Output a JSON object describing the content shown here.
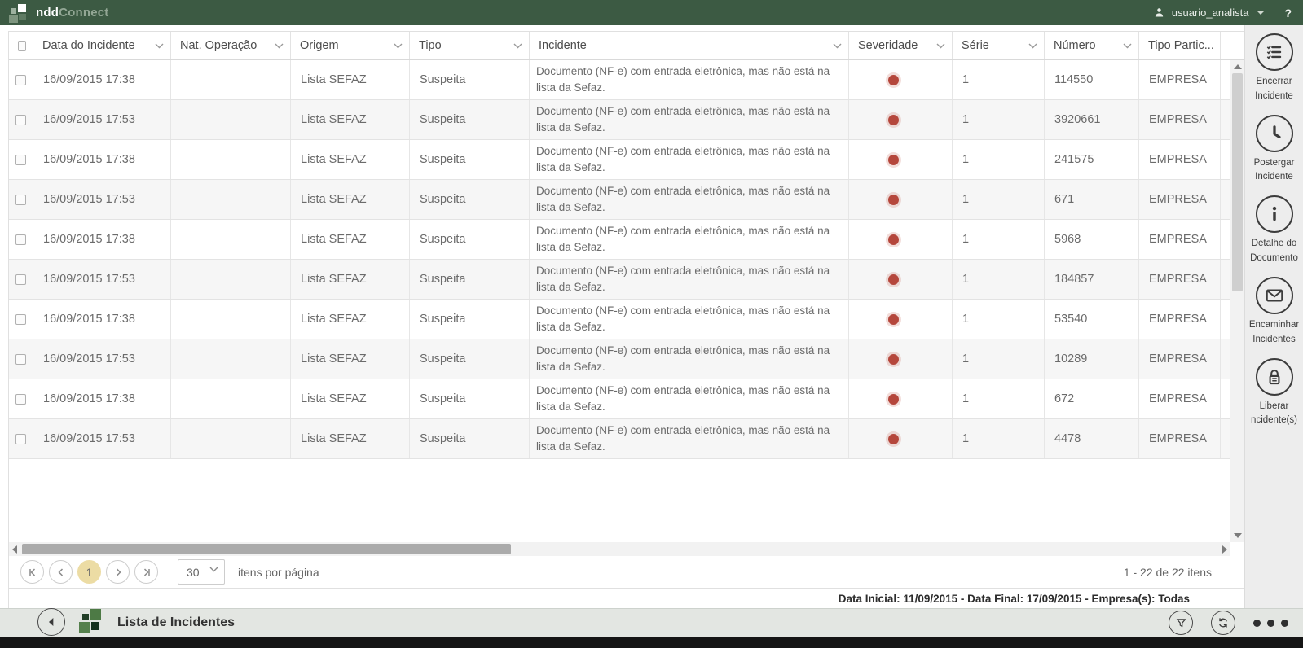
{
  "topbar": {
    "logo_bold": "ndd",
    "logo_light": "Connect",
    "username": "usuario_analista",
    "help_label": "?"
  },
  "table": {
    "columns": [
      {
        "label": "Data do Incidente"
      },
      {
        "label": "Nat. Operação"
      },
      {
        "label": "Origem"
      },
      {
        "label": "Tipo"
      },
      {
        "label": "Incidente"
      },
      {
        "label": "Severidade"
      },
      {
        "label": "Série"
      },
      {
        "label": "Número"
      },
      {
        "label": "Tipo Partic..."
      }
    ],
    "rows": [
      {
        "date": "16/09/2015 17:38",
        "nat_operacao": "",
        "origem": "Lista SEFAZ",
        "tipo": "Suspeita",
        "incidente": "Documento (NF-e)  com entrada eletrônica, mas não está na\nlista da Sefaz.",
        "severidade": "red",
        "serie": "1",
        "numero": "114550",
        "tipo_partic": "EMPRESA"
      },
      {
        "date": "16/09/2015 17:53",
        "nat_operacao": "",
        "origem": "Lista SEFAZ",
        "tipo": "Suspeita",
        "incidente": "Documento (NF-e) com entrada eletrônica, mas não está na\nlista da Sefaz.",
        "severidade": "red",
        "serie": "1",
        "numero": "3920661",
        "tipo_partic": "EMPRESA"
      },
      {
        "date": "16/09/2015 17:38",
        "nat_operacao": "",
        "origem": "Lista SEFAZ",
        "tipo": "Suspeita",
        "incidente": "Documento (NF-e)  com entrada eletrônica, mas não está na\nlista da Sefaz.",
        "severidade": "red",
        "serie": "1",
        "numero": "241575",
        "tipo_partic": "EMPRESA"
      },
      {
        "date": "16/09/2015 17:53",
        "nat_operacao": "",
        "origem": "Lista SEFAZ",
        "tipo": "Suspeita",
        "incidente": "Documento (NF-e) com entrada eletrônica, mas não está na\nlista da Sefaz.",
        "severidade": "red",
        "serie": "1",
        "numero": "671",
        "tipo_partic": "EMPRESA"
      },
      {
        "date": "16/09/2015 17:38",
        "nat_operacao": "",
        "origem": "Lista SEFAZ",
        "tipo": "Suspeita",
        "incidente": "Documento (NF-e)  com entrada eletrônica, mas não está na\nlista da Sefaz.",
        "severidade": "red",
        "serie": "1",
        "numero": "5968",
        "tipo_partic": "EMPRESA"
      },
      {
        "date": "16/09/2015 17:53",
        "nat_operacao": "",
        "origem": "Lista SEFAZ",
        "tipo": "Suspeita",
        "incidente": "Documento (NF-e) com entrada eletrônica, mas não está na\nlista da Sefaz.",
        "severidade": "red",
        "serie": "1",
        "numero": "184857",
        "tipo_partic": "EMPRESA"
      },
      {
        "date": "16/09/2015 17:38",
        "nat_operacao": "",
        "origem": "Lista SEFAZ",
        "tipo": "Suspeita",
        "incidente": "Documento (NF-e)  com entrada eletrônica, mas não está na\nlista da Sefaz.",
        "severidade": "red",
        "serie": "1",
        "numero": "53540",
        "tipo_partic": "EMPRESA"
      },
      {
        "date": "16/09/2015 17:53",
        "nat_operacao": "",
        "origem": "Lista SEFAZ",
        "tipo": "Suspeita",
        "incidente": "Documento (NF-e) com entrada eletrônica, mas não está na\nlista da Sefaz.",
        "severidade": "red",
        "serie": "1",
        "numero": "10289",
        "tipo_partic": "EMPRESA"
      },
      {
        "date": "16/09/2015 17:38",
        "nat_operacao": "",
        "origem": "Lista SEFAZ",
        "tipo": "Suspeita",
        "incidente": "Documento (NF-e)  com entrada eletrônica, mas não está na\nlista da Sefaz.",
        "severidade": "red",
        "serie": "1",
        "numero": "672",
        "tipo_partic": "EMPRESA"
      },
      {
        "date": "16/09/2015 17:53",
        "nat_operacao": "",
        "origem": "Lista SEFAZ",
        "tipo": "Suspeita",
        "incidente": "Documento (NF-e) com entrada eletrônica, mas não está na\nlista da Sefaz.",
        "severidade": "red",
        "serie": "1",
        "numero": "4478",
        "tipo_partic": "EMPRESA"
      }
    ]
  },
  "sidebar": {
    "actions": [
      {
        "icon": "checklist-icon",
        "label": "Encerrar Incidente"
      },
      {
        "icon": "clock-icon",
        "label": "Postergar Incidente"
      },
      {
        "icon": "info-icon",
        "label": "Detalhe do Documento"
      },
      {
        "icon": "envelope-icon",
        "label": "Encaminhar Incidentes"
      },
      {
        "icon": "lock-icon",
        "label": "Liberar ncidente(s)"
      }
    ]
  },
  "pager": {
    "current_page": "1",
    "page_size": "30",
    "page_size_label": "itens por página",
    "range_label": "1 - 22 de 22 itens"
  },
  "status_line": "Data Inicial: 11/09/2015  -  Data Final: 17/09/2015  -  Empresa(s): Todas",
  "bottombar": {
    "title": "Lista de Incidentes"
  },
  "colors": {
    "topbar_green": "#3c5a43",
    "severity_red": "#b5473c",
    "active_page_bg": "#ecdca4"
  }
}
